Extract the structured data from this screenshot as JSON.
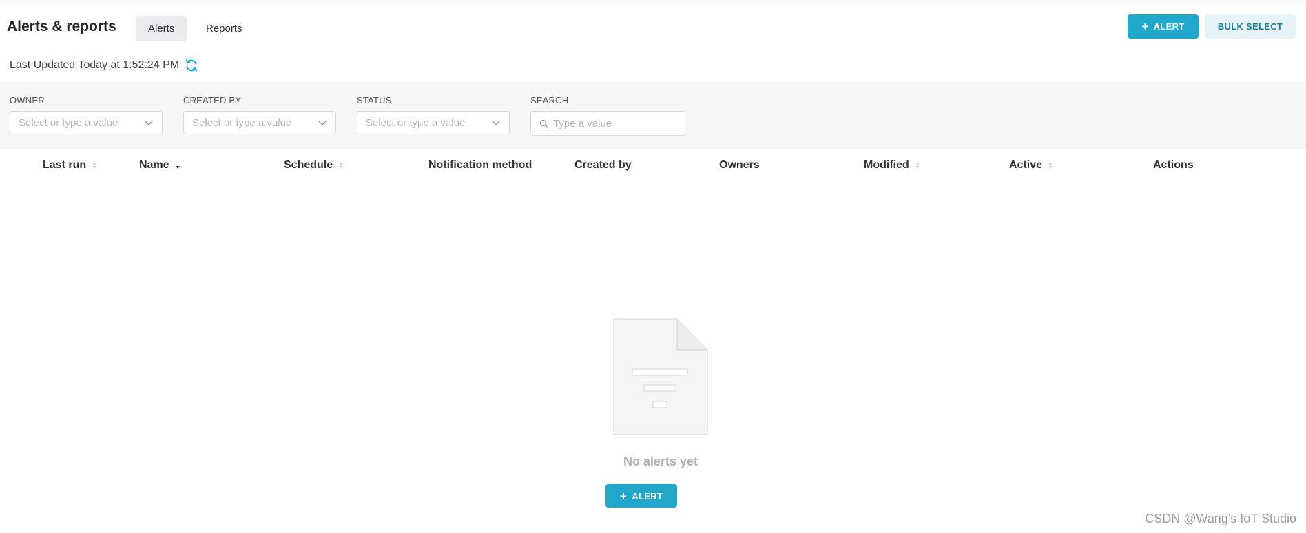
{
  "header": {
    "title": "Alerts & reports",
    "tabs": [
      {
        "label": "Alerts",
        "active": true
      },
      {
        "label": "Reports",
        "active": false
      }
    ],
    "add_alert_label": "ALERT",
    "bulk_select_label": "BULK SELECT",
    "last_updated": "Last Updated Today at 1:52:24 PM"
  },
  "filters": [
    {
      "label": "OWNER",
      "placeholder": "Select or type a value"
    },
    {
      "label": "CREATED BY",
      "placeholder": "Select or type a value"
    },
    {
      "label": "STATUS",
      "placeholder": "Select or type a value"
    },
    {
      "label": "SEARCH",
      "placeholder": "Type a value"
    }
  ],
  "table": {
    "columns": [
      {
        "label": "Last run",
        "sortable": true
      },
      {
        "label": "Name",
        "sortable": true,
        "sorted": "desc"
      },
      {
        "label": "Schedule",
        "sortable": true
      },
      {
        "label": "Notification method",
        "sortable": false
      },
      {
        "label": "Created by",
        "sortable": false
      },
      {
        "label": "Owners",
        "sortable": false
      },
      {
        "label": "Modified",
        "sortable": true
      },
      {
        "label": "Active",
        "sortable": true
      },
      {
        "label": "Actions",
        "sortable": false
      }
    ]
  },
  "empty_state": {
    "message": "No alerts yet",
    "button_label": "ALERT",
    "icon": "empty-document-icon"
  },
  "watermark": "CSDN @Wang's IoT Studio",
  "colors": {
    "primary": "#20a7c9",
    "secondary_bg": "#e6f3f8",
    "tab_active_bg": "#e9ebef",
    "filter_bar_bg": "#f6f6f6"
  }
}
